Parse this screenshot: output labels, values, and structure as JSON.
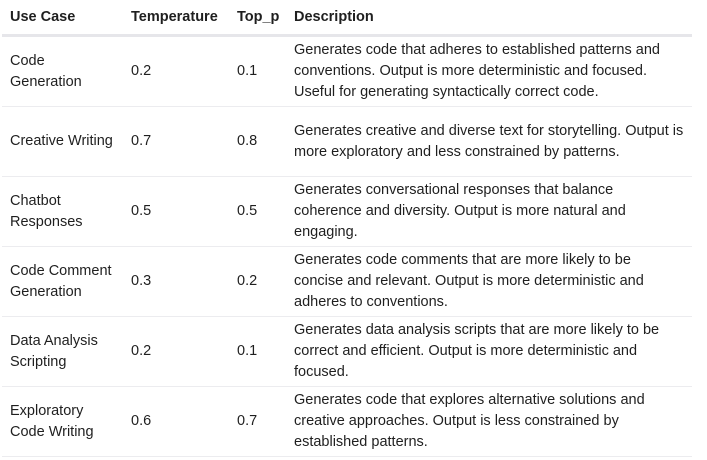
{
  "headers": [
    "Use Case",
    "Temperature",
    "Top_p",
    "Description"
  ],
  "rows": [
    {
      "use_case": "Code Generation",
      "temperature": "0.2",
      "top_p": "0.1",
      "description": "Generates code that adheres to established patterns and conventions. Output is more deterministic and focused. Useful for generating syntactically correct code."
    },
    {
      "use_case": "Creative Writing",
      "temperature": "0.7",
      "top_p": "0.8",
      "description": "Generates creative and diverse text for storytelling. Output is more exploratory and less constrained by patterns."
    },
    {
      "use_case": "Chatbot Responses",
      "temperature": "0.5",
      "top_p": "0.5",
      "description": "Generates conversational responses that balance coherence and diversity. Output is more natural and engaging."
    },
    {
      "use_case": "Code Comment Generation",
      "temperature": "0.3",
      "top_p": "0.2",
      "description": "Generates code comments that are more likely to be concise and relevant. Output is more deterministic and adheres to conventions."
    },
    {
      "use_case": "Data Analysis Scripting",
      "temperature": "0.2",
      "top_p": "0.1",
      "description": "Generates data analysis scripts that are more likely to be correct and efficient. Output is more deterministic and focused."
    },
    {
      "use_case": "Exploratory Code Writing",
      "temperature": "0.6",
      "top_p": "0.7",
      "description": "Generates code that explores alternative solutions and creative approaches. Output is less constrained by established patterns."
    }
  ]
}
